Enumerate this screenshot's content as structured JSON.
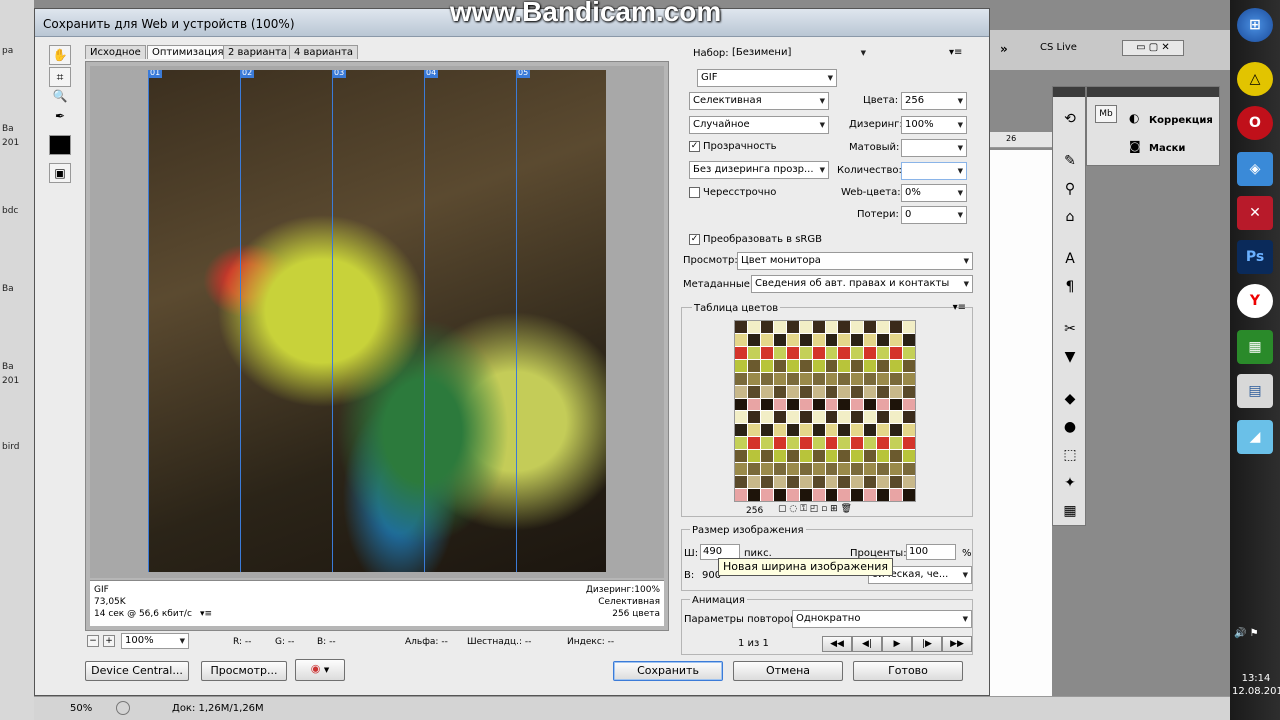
{
  "desktop": {
    "left_labels": [
      "ра",
      "Ва",
      "201",
      "bdc",
      "Ва",
      "Ва",
      "201",
      "bird"
    ],
    "clock_time": "13:14",
    "clock_date": "12.08.201",
    "status_zoom": "50%",
    "status_doc": "Док: 1,26M/1,26M",
    "cs_live": "CS Live",
    "ruler_label": "26"
  },
  "watermark": "www.Bandicam.com",
  "dialog": {
    "title": "Сохранить для Web и устройств (100%)",
    "tabs": [
      {
        "label": "Исходное"
      },
      {
        "label": "Оптимизация"
      },
      {
        "label": "2 варианта"
      },
      {
        "label": "4 варианта"
      }
    ],
    "slices": [
      "01",
      "02",
      "03",
      "04",
      "05"
    ],
    "preview_info": {
      "format": "GIF",
      "size": "73,05K",
      "time": "14 сек @ 56,6 кбит/с",
      "dither": "Дизеринг:100%",
      "palette": "Селективная",
      "colors": "256 цвета"
    },
    "zoom": {
      "value": "100%",
      "r": "R: --",
      "g": "G: --",
      "b": "B: --",
      "alpha": "Альфа: --",
      "hex": "Шестнадц.: --",
      "index": "Индекс: --"
    },
    "buttons": {
      "device_central": "Device Central...",
      "preview": "Просмотр...",
      "save": "Сохранить",
      "cancel": "Отмена",
      "done": "Готово"
    },
    "settings": {
      "preset_label": "Набор:",
      "preset_value": "[Безимени]",
      "format": "GIF",
      "reduction": "Селективная",
      "colors_label": "Цвета:",
      "colors_value": "256",
      "dither_algo": "Случайное",
      "dither_label": "Дизеринг:",
      "dither_value": "100%",
      "transparency_label": "Прозрачность",
      "matte_label": "Матовый:",
      "transp_dither": "Без дизеринга прозр...",
      "amount_label": "Количество:",
      "interlaced_label": "Чересстрочно",
      "websnap_label": "Web-цвета:",
      "websnap_value": "0%",
      "lossy_label": "Потери:",
      "lossy_value": "0",
      "srgb_label": "Преобразовать в sRGB",
      "preview_label": "Просмотр:",
      "preview_value": "Цвет монитора",
      "metadata_label": "Метаданные:",
      "metadata_value": "Сведения об авт. правах и контакты"
    },
    "color_table": {
      "title": "Таблица цветов",
      "count": "256",
      "colors": [
        "#3a2a1a",
        "#c8b88a",
        "#6b5a2e",
        "#e4d68a",
        "#1e140a",
        "#9a8a4a",
        "#d4342a",
        "#f2eec6",
        "#5a4a2a",
        "#b8c43a",
        "#2a2216",
        "#e8a4a4",
        "#7a6a3a",
        "#c4d058"
      ]
    },
    "image_size": {
      "title": "Размер изображения",
      "w_label": "Ш:",
      "w_value": "490",
      "w_unit": "пикс.",
      "h_label": "В:",
      "h_value": "900",
      "percent_label": "Проценты:",
      "percent_value": "100",
      "percent_unit": "%",
      "quality_value": "бическая, че..."
    },
    "animation": {
      "title": "Анимация",
      "loop_label": "Параметры повторов:",
      "loop_value": "Однократно",
      "frame": "1 из 1"
    },
    "tooltip": "Новая ширина изображения"
  },
  "palettes": {
    "adjustments": "Коррекция",
    "masks": "Маски"
  }
}
